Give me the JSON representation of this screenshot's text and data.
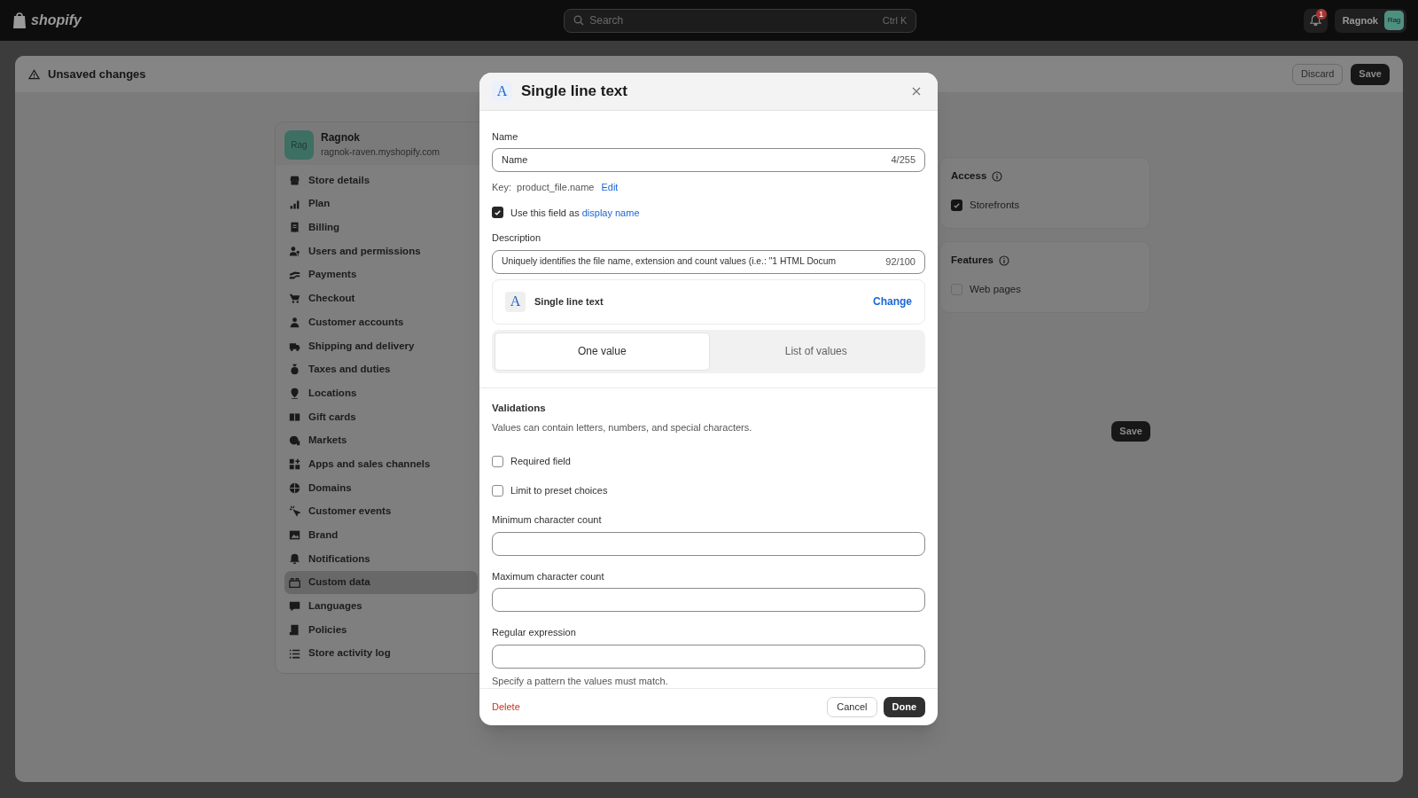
{
  "topbar": {
    "logo": "shopify",
    "search": {
      "placeholder": "Search",
      "shortcut": "Ctrl K"
    },
    "notification_count": "1",
    "user": {
      "name": "Ragnok",
      "avatar": "Rag"
    }
  },
  "unsaved_bar": {
    "title": "Unsaved changes",
    "buttons": [
      "Discard",
      "Save"
    ]
  },
  "sidebar": {
    "store": {
      "avatar": "Rag",
      "name": "Ragnok",
      "url": "ragnok-raven.myshopify.com"
    },
    "items": [
      {
        "label": "Store details",
        "selected": false
      },
      {
        "label": "Plan",
        "selected": false
      },
      {
        "label": "Billing",
        "selected": false
      },
      {
        "label": "Users and permissions",
        "selected": false
      },
      {
        "label": "Payments",
        "selected": false
      },
      {
        "label": "Checkout",
        "selected": false
      },
      {
        "label": "Customer accounts",
        "selected": false
      },
      {
        "label": "Shipping and delivery",
        "selected": false
      },
      {
        "label": "Taxes and duties",
        "selected": false
      },
      {
        "label": "Locations",
        "selected": false
      },
      {
        "label": "Gift cards",
        "selected": false
      },
      {
        "label": "Markets",
        "selected": false
      },
      {
        "label": "Apps and sales channels",
        "selected": false
      },
      {
        "label": "Domains",
        "selected": false
      },
      {
        "label": "Customer events",
        "selected": false
      },
      {
        "label": "Brand",
        "selected": false
      },
      {
        "label": "Notifications",
        "selected": false
      },
      {
        "label": "Custom data",
        "selected": true
      },
      {
        "label": "Languages",
        "selected": false
      },
      {
        "label": "Policies",
        "selected": false
      },
      {
        "label": "Store activity log",
        "selected": false
      }
    ]
  },
  "side_cards": [
    {
      "title": "Access",
      "options": [
        {
          "label": "Storefronts",
          "checked": true
        }
      ]
    },
    {
      "title": "Features",
      "options": [
        {
          "label": "Web pages",
          "checked": false
        }
      ]
    }
  ],
  "page_save_button": "Save",
  "dialog": {
    "icon": "A",
    "title": "Single line text",
    "name_field": {
      "label": "Name",
      "value": "Name",
      "counter": "4/255"
    },
    "key": {
      "label": "Key:",
      "value": "product_file.name",
      "link": "Edit"
    },
    "display_name": {
      "checked": true,
      "text": "Use this field as",
      "link": "display name"
    },
    "description_field": {
      "label": "Description",
      "value": "Uniquely identifies the file name, extension and count values (i.e.: \"1 HTML Docum",
      "counter": "92/100"
    },
    "type_card": {
      "icon": "A",
      "label": "Single line text",
      "action": "Change"
    },
    "segments": [
      {
        "label": "One value",
        "selected": true
      },
      {
        "label": "List of values",
        "selected": false
      }
    ],
    "validations": {
      "title": "Validations",
      "hint": "Values can contain letters, numbers, and special characters.",
      "checks": [
        {
          "label": "Required field",
          "checked": false
        },
        {
          "label": "Limit to preset choices",
          "checked": false
        }
      ],
      "fields": [
        {
          "label": "Minimum character count"
        },
        {
          "label": "Maximum character count"
        },
        {
          "label": "Regular expression",
          "help": "Specify a pattern the values must match."
        }
      ]
    },
    "footer": {
      "delete": "Delete",
      "cancel": "Cancel",
      "done": "Done"
    }
  }
}
